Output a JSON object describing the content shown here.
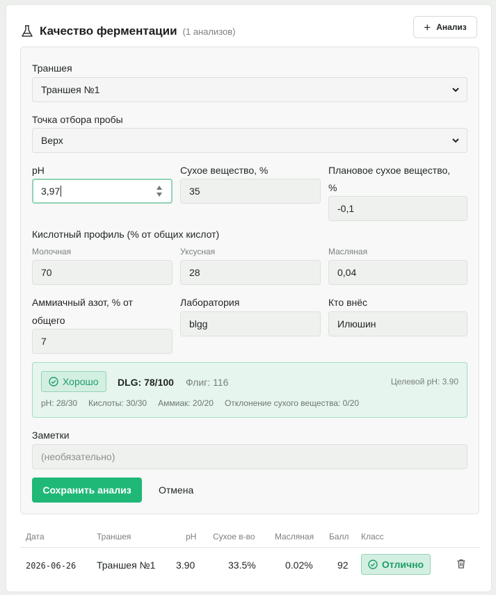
{
  "header": {
    "title": "Качество ферментации",
    "count": "(1 анализов)",
    "add_button": "Анализ"
  },
  "form": {
    "trench": {
      "label": "Траншея",
      "value": "Траншея №1"
    },
    "sample_point": {
      "label": "Точка отбора пробы",
      "value": "Верх"
    },
    "ph": {
      "label": "pH",
      "value": "3,97"
    },
    "dry_matter": {
      "label": "Сухое вещество, %",
      "value": "35"
    },
    "planned_dry_matter": {
      "label_line1": "Плановое сухое вещество,",
      "label_line2": "%",
      "value": "-0,1"
    },
    "acid_profile": {
      "label": "Кислотный профиль (% от общих кислот)",
      "lactic": {
        "label": "Молочная",
        "value": "70"
      },
      "acetic": {
        "label": "Уксусная",
        "value": "28"
      },
      "butyric": {
        "label": "Масляная",
        "value": "0,04"
      }
    },
    "ammonia": {
      "label_line1": "Аммиачный азот, % от",
      "label_line2": "общего",
      "value": "7"
    },
    "laboratory": {
      "label": "Лаборатория",
      "value": "blgg"
    },
    "entered_by": {
      "label": "Кто внёс",
      "value": "Илюшин"
    },
    "grade": {
      "badge": "Хорошо",
      "dlg": "DLG: 78/100",
      "flig": "Флиг: 116",
      "target_ph": "Целевой pH: 3.90",
      "metrics": [
        "pH: 28/30",
        "Кислоты: 30/30",
        "Аммиак: 20/20",
        "Отклонение сухого вещества: 0/20"
      ]
    },
    "notes": {
      "label": "Заметки",
      "placeholder": "(необязательно)"
    },
    "save_button": "Сохранить анализ",
    "cancel_button": "Отмена"
  },
  "table": {
    "columns": [
      "Дата",
      "Траншея",
      "pH",
      "Сухое в-во",
      "Масляная",
      "Балл",
      "Класс"
    ],
    "rows": [
      {
        "date": "2026-06-26",
        "trench": "Траншея №1",
        "ph": "3.90",
        "dry_matter": "33.5%",
        "butyric": "0.02%",
        "score": "92",
        "class": "Отлично"
      }
    ]
  },
  "colors": {
    "accent": "#1fb877",
    "success_text": "#1d9d66",
    "success_bg": "#e6f5ee"
  },
  "icons": {
    "header": "flask-icon",
    "add": "plus-icon",
    "select": "chevron-down-icon",
    "badge": "check-circle-icon",
    "row_action": "trash-icon"
  }
}
